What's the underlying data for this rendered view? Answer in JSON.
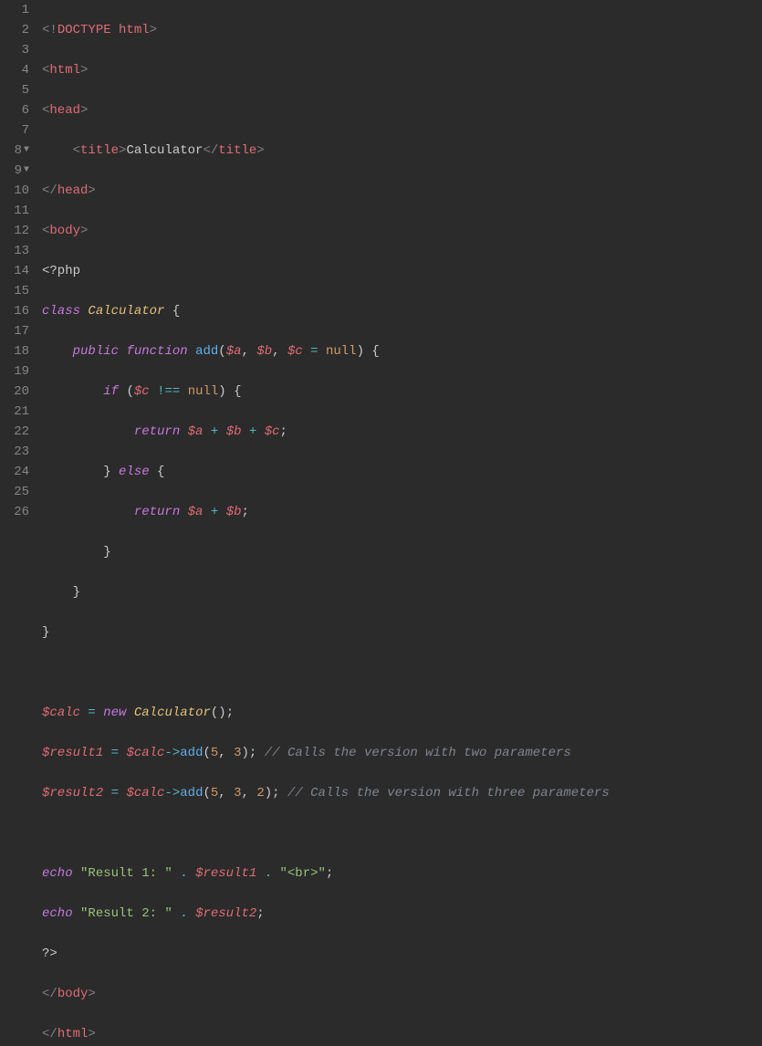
{
  "lineNumbers": [
    "1",
    "2",
    "3",
    "4",
    "5",
    "6",
    "7",
    "8",
    "9",
    "10",
    "11",
    "12",
    "13",
    "14",
    "15",
    "16",
    "17",
    "18",
    "19",
    "20",
    "21",
    "22",
    "23",
    "24",
    "25",
    "26"
  ],
  "foldLines": [
    8,
    9
  ],
  "code": {
    "l1": {
      "a": "<!",
      "b": "DOCTYPE html",
      "c": ">"
    },
    "l2": {
      "a": "<",
      "b": "html",
      "c": ">"
    },
    "l3": {
      "a": "<",
      "b": "head",
      "c": ">"
    },
    "l4": {
      "indent": "    ",
      "a": "<",
      "b": "title",
      "c": ">",
      "text": "Calculator",
      "d": "</",
      "e": "title",
      "f": ">"
    },
    "l5": {
      "a": "</",
      "b": "head",
      "c": ">"
    },
    "l6": {
      "a": "<",
      "b": "body",
      "c": ">"
    },
    "l7": {
      "text": "<?php"
    },
    "l8": {
      "kw": "class",
      "sp": " ",
      "name": "Calculator",
      "sp2": " ",
      "brace": "{"
    },
    "l9": {
      "indent": "    ",
      "pub": "public",
      "sp": " ",
      "func": "function",
      "sp2": " ",
      "name": "add",
      "p1": "(",
      "v1": "$a",
      "c1": ",",
      "sp3": " ",
      "v2": "$b",
      "c2": ",",
      "sp4": " ",
      "v3": "$c",
      "sp5": " ",
      "eq": "=",
      "sp6": " ",
      "null": "null",
      "p2": ")",
      "sp7": " ",
      "brace": "{"
    },
    "l10": {
      "indent": "        ",
      "if": "if",
      "sp": " ",
      "p1": "(",
      "v": "$c",
      "sp2": " ",
      "op": "!==",
      "sp3": " ",
      "null": "null",
      "p2": ")",
      "sp4": " ",
      "brace": "{"
    },
    "l11": {
      "indent": "            ",
      "ret": "return",
      "sp": " ",
      "v1": "$a",
      "sp2": " ",
      "op1": "+",
      "sp3": " ",
      "v2": "$b",
      "sp4": " ",
      "op2": "+",
      "sp5": " ",
      "v3": "$c",
      "semi": ";"
    },
    "l12": {
      "indent": "        ",
      "brace": "}",
      "sp": " ",
      "else": "else",
      "sp2": " ",
      "brace2": "{"
    },
    "l13": {
      "indent": "            ",
      "ret": "return",
      "sp": " ",
      "v1": "$a",
      "sp2": " ",
      "op": "+",
      "sp3": " ",
      "v2": "$b",
      "semi": ";"
    },
    "l14": {
      "indent": "        ",
      "brace": "}"
    },
    "l15": {
      "indent": "    ",
      "brace": "}"
    },
    "l16": {
      "brace": "}"
    },
    "l17": {
      "text": ""
    },
    "l18": {
      "v": "$calc",
      "sp": " ",
      "eq": "=",
      "sp2": " ",
      "new": "new",
      "sp3": " ",
      "cls": "Calculator",
      "p": "()",
      "semi": ";"
    },
    "l19": {
      "v": "$result1",
      "sp": " ",
      "eq": "=",
      "sp2": " ",
      "v2": "$calc",
      "arrow": "->",
      "fn": "add",
      "p1": "(",
      "n1": "5",
      "c": ",",
      "sp3": " ",
      "n2": "3",
      "p2": ")",
      "semi": ";",
      "sp4": " ",
      "comment": "// Calls the version with two parameters"
    },
    "l20": {
      "v": "$result2",
      "sp": " ",
      "eq": "=",
      "sp2": " ",
      "v2": "$calc",
      "arrow": "->",
      "fn": "add",
      "p1": "(",
      "n1": "5",
      "c1": ",",
      "sp3": " ",
      "n2": "3",
      "c2": ",",
      "sp4": " ",
      "n3": "2",
      "p2": ")",
      "semi": ";",
      "sp5": " ",
      "comment": "// Calls the version with three parameters"
    },
    "l21": {
      "text": ""
    },
    "l22": {
      "echo": "echo",
      "sp": " ",
      "s1": "\"Result 1: \"",
      "sp2": " ",
      "dot1": ".",
      "sp3": " ",
      "v": "$result1",
      "sp4": " ",
      "dot2": ".",
      "sp5": " ",
      "s2": "\"<br>\"",
      "semi": ";"
    },
    "l23": {
      "echo": "echo",
      "sp": " ",
      "s1": "\"Result 2: \"",
      "sp2": " ",
      "dot": ".",
      "sp3": " ",
      "v": "$result2",
      "semi": ";"
    },
    "l24": {
      "text": "?>"
    },
    "l25": {
      "a": "</",
      "b": "body",
      "c": ">"
    },
    "l26": {
      "a": "</",
      "b": "html",
      "c": ">"
    }
  }
}
